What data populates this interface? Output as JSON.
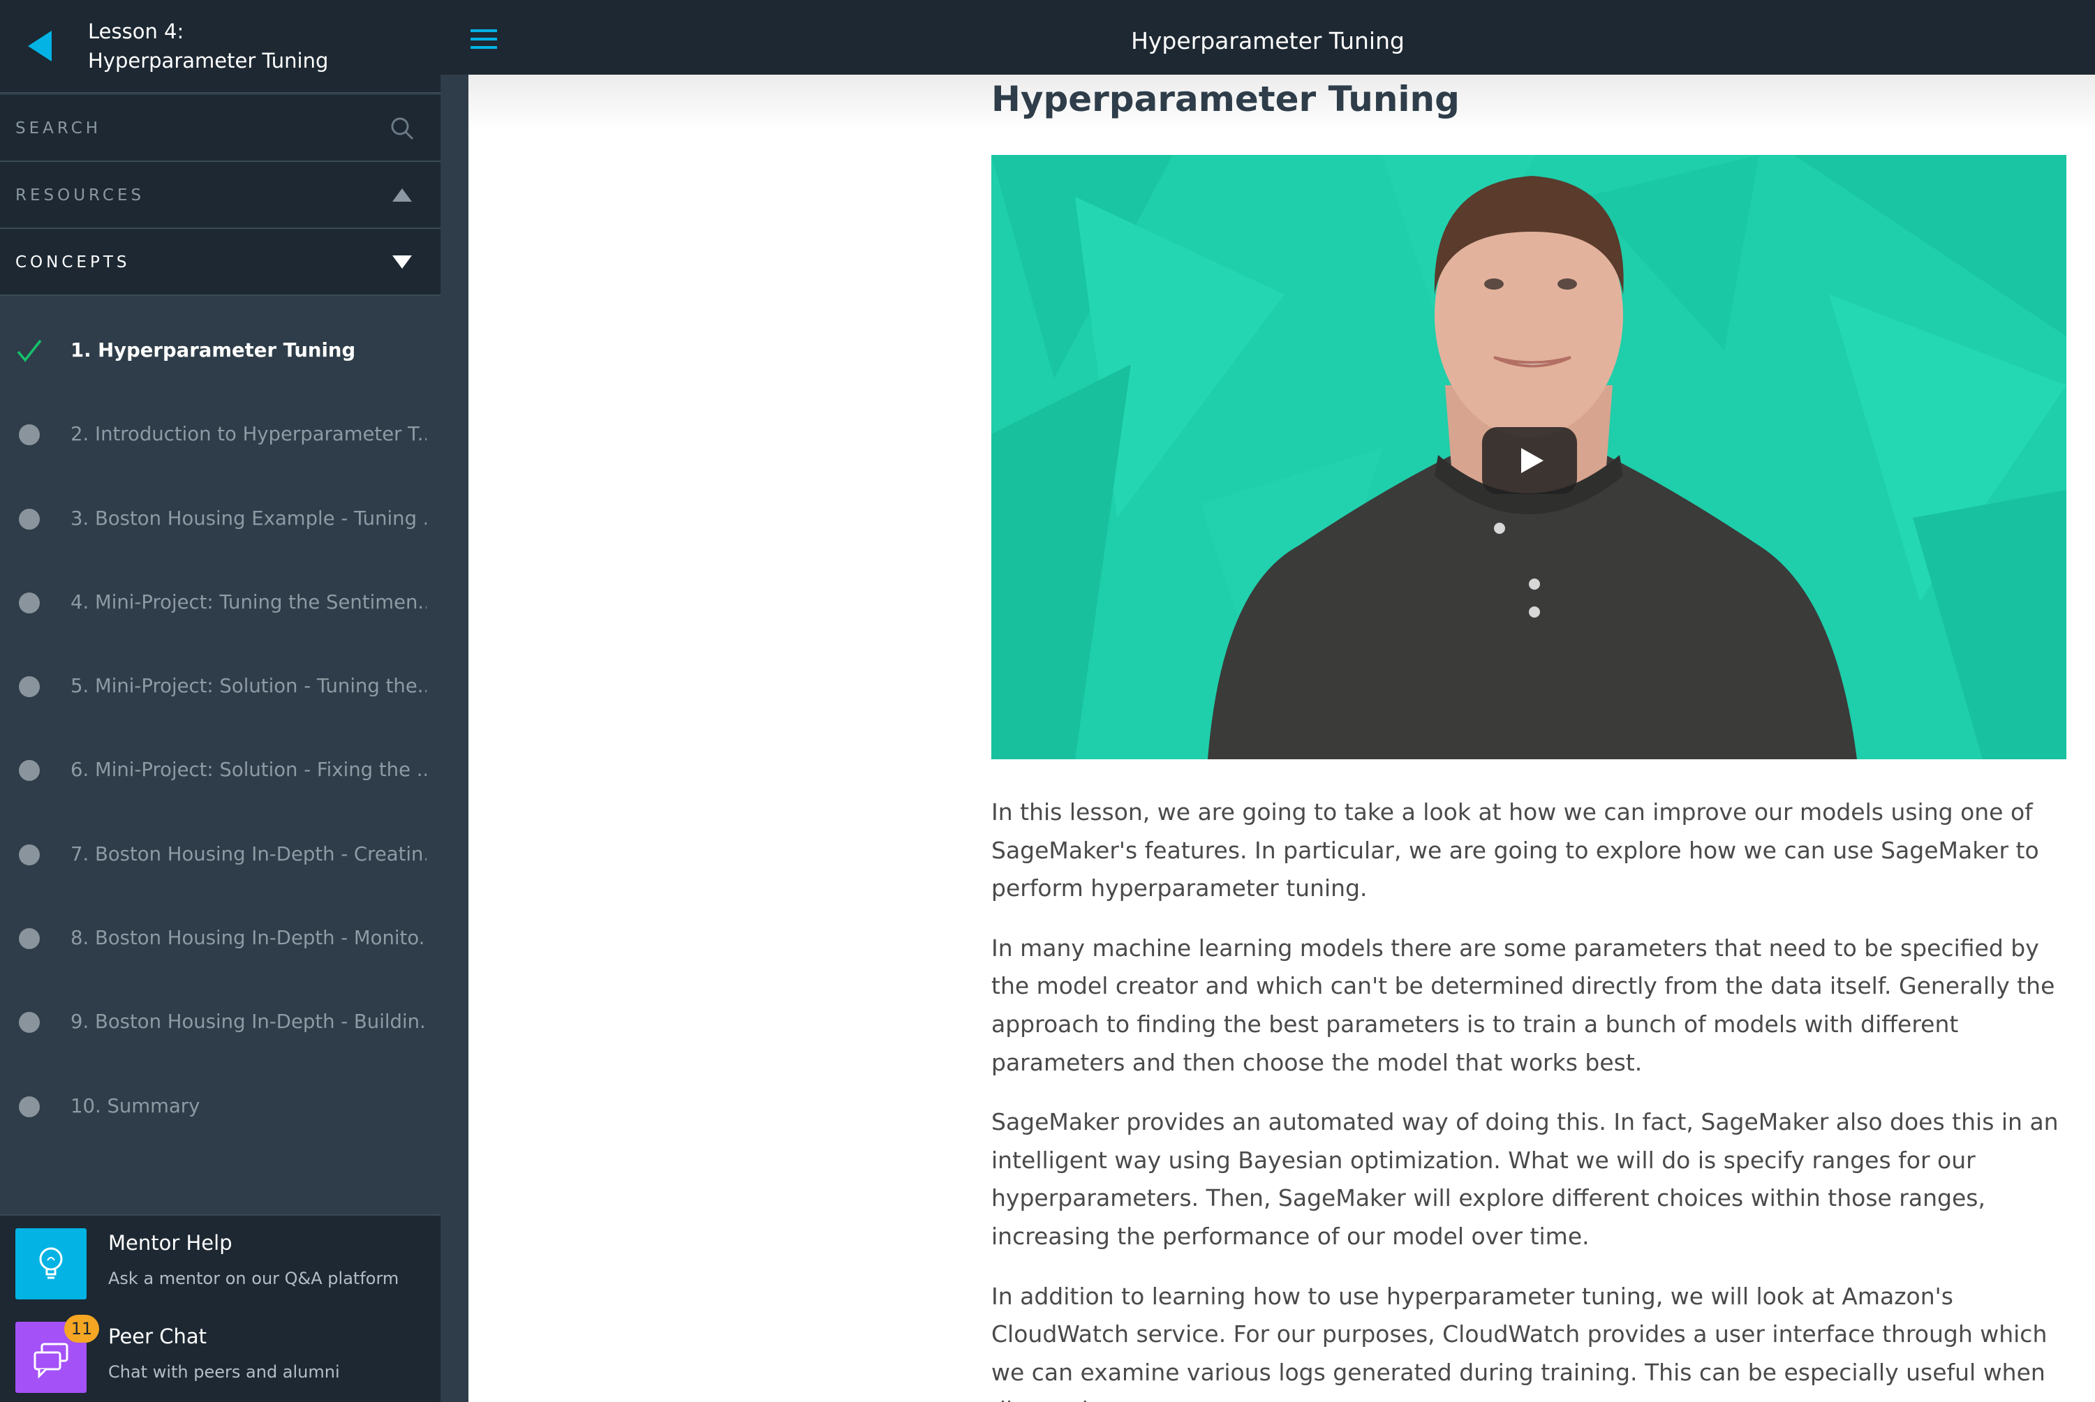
{
  "lesson": {
    "line1": "Lesson 4:",
    "line2": "Hyperparameter Tuning"
  },
  "sidebar": {
    "search_label": "SEARCH",
    "resources_label": "RESOURCES",
    "concepts_label": "CONCEPTS",
    "concepts": [
      {
        "label": "1. Hyperparameter Tuning",
        "state": "completed"
      },
      {
        "label": "2. Introduction to Hyperparameter T...",
        "state": "pending"
      },
      {
        "label": "3. Boston Housing Example - Tuning ...",
        "state": "pending"
      },
      {
        "label": "4. Mini-Project: Tuning the Sentimen...",
        "state": "pending"
      },
      {
        "label": "5. Mini-Project: Solution - Tuning the...",
        "state": "pending"
      },
      {
        "label": "6. Mini-Project: Solution - Fixing the ...",
        "state": "pending"
      },
      {
        "label": "7. Boston Housing In-Depth - Creatin...",
        "state": "pending"
      },
      {
        "label": "8. Boston Housing In-Depth - Monito...",
        "state": "pending"
      },
      {
        "label": "9. Boston Housing In-Depth - Buildin...",
        "state": "pending"
      },
      {
        "label": "10. Summary",
        "state": "pending"
      }
    ]
  },
  "help": {
    "mentor": {
      "title": "Mentor Help",
      "subtitle": "Ask a mentor on our Q&A platform"
    },
    "peer": {
      "title": "Peer Chat",
      "subtitle": "Chat with peers and alumni",
      "badge": "11"
    }
  },
  "topbar": {
    "title": "Hyperparameter Tuning"
  },
  "main": {
    "title": "Hyperparameter Tuning",
    "paragraphs": [
      "In this lesson, we are going to take a look at how we can improve our models using one of SageMaker's features. In particular, we are going to explore how we can use SageMaker to perform hyperparameter tuning.",
      "In many machine learning models there are some parameters that need to be specified by the model creator and which can't be determined directly from the data itself. Generally the approach to finding the best parameters is to train a bunch of models with different parameters and then choose the model that works best.",
      "SageMaker provides an automated way of doing this. In fact, SageMaker also does this in an intelligent way using Bayesian optimization. What we will do is specify ranges for our hyperparameters. Then, SageMaker will explore different choices within those ranges, increasing the performance of our model over time.",
      "In addition to learning how to use hyperparameter tuning, we will look at Amazon's CloudWatch service. For our purposes, CloudWatch provides a user interface through which we can examine various logs generated during training. This can be especially useful when diagnosing errors."
    ]
  },
  "colors": {
    "sidebar_bg": "#2e3d49",
    "sidebar_header_bg": "#1d2832",
    "accent": "#02b3e4",
    "check": "#15c26b",
    "video_bg": "#1fceaa",
    "mentor_icon_bg": "#02b3e4",
    "peer_icon_bg": "#a451f7",
    "badge": "#f5a623"
  }
}
